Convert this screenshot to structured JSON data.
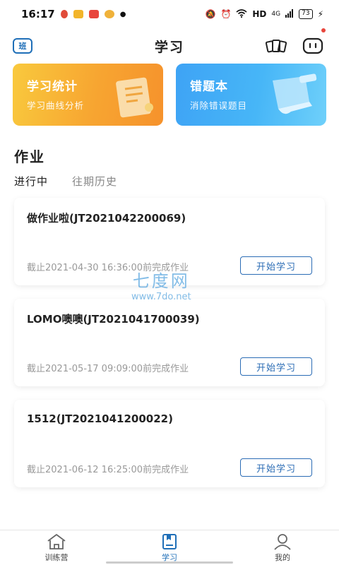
{
  "status_bar": {
    "time": "16:17",
    "network": "HD",
    "signal": "4G",
    "battery": "73"
  },
  "header": {
    "title": "学习",
    "class_label": "班"
  },
  "features": [
    {
      "title": "学习统计",
      "subtitle": "学习曲线分析"
    },
    {
      "title": "错题本",
      "subtitle": "消除错误题目"
    }
  ],
  "section": {
    "title": "作业",
    "tabs": [
      "进行中",
      "往期历史"
    ]
  },
  "homework": [
    {
      "title": "做作业啦(JT2021042200069)",
      "deadline": "截止2021-04-30 16:36:00前完成作业",
      "button": "开始学习"
    },
    {
      "title": "LOMO噢噢(JT2021041700039)",
      "deadline": "截止2021-05-17 09:09:00前完成作业",
      "button": "开始学习"
    },
    {
      "title": "1512(JT2021041200022)",
      "deadline": "截止2021-06-12 16:25:00前完成作业",
      "button": "开始学习"
    }
  ],
  "watermark": {
    "main": "七度网",
    "url": "www.7do.net"
  },
  "bottom_nav": [
    {
      "label": "训练营",
      "icon": "home-icon"
    },
    {
      "label": "学习",
      "icon": "study-icon"
    },
    {
      "label": "我的",
      "icon": "profile-icon"
    }
  ],
  "colors": {
    "accent": "#1f6fb8",
    "stats_card": "#f7a531",
    "wrong_card": "#47b6f7"
  }
}
